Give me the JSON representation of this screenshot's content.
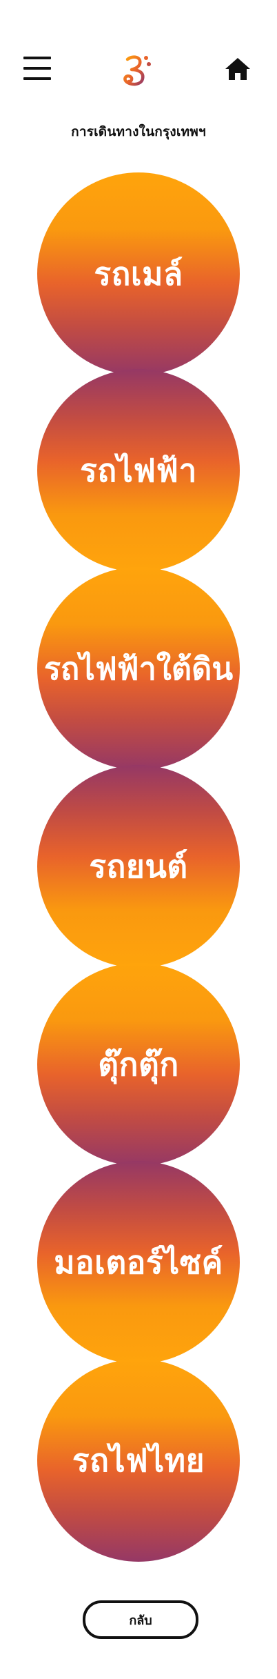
{
  "header": {
    "menu_icon": "hamburger-menu-icon",
    "logo_icon": "brand-logo-icon",
    "home_icon": "home-icon",
    "brand_colors": [
      "#ffa40c",
      "#e8632b",
      "#953865"
    ]
  },
  "page": {
    "title": "การเดินทางในกรุงเทพฯ"
  },
  "transport_options": [
    {
      "label": "รถเมล์"
    },
    {
      "label": "รถไฟฟ้า"
    },
    {
      "label": "รถไฟฟ้าใต้ดิน"
    },
    {
      "label": "รถยนต์"
    },
    {
      "label": "ตุ๊กตุ๊ก"
    },
    {
      "label": "มอเตอร์ไซค์"
    },
    {
      "label": "รถไฟไทย"
    }
  ],
  "footer": {
    "back_label": "กลับ"
  }
}
